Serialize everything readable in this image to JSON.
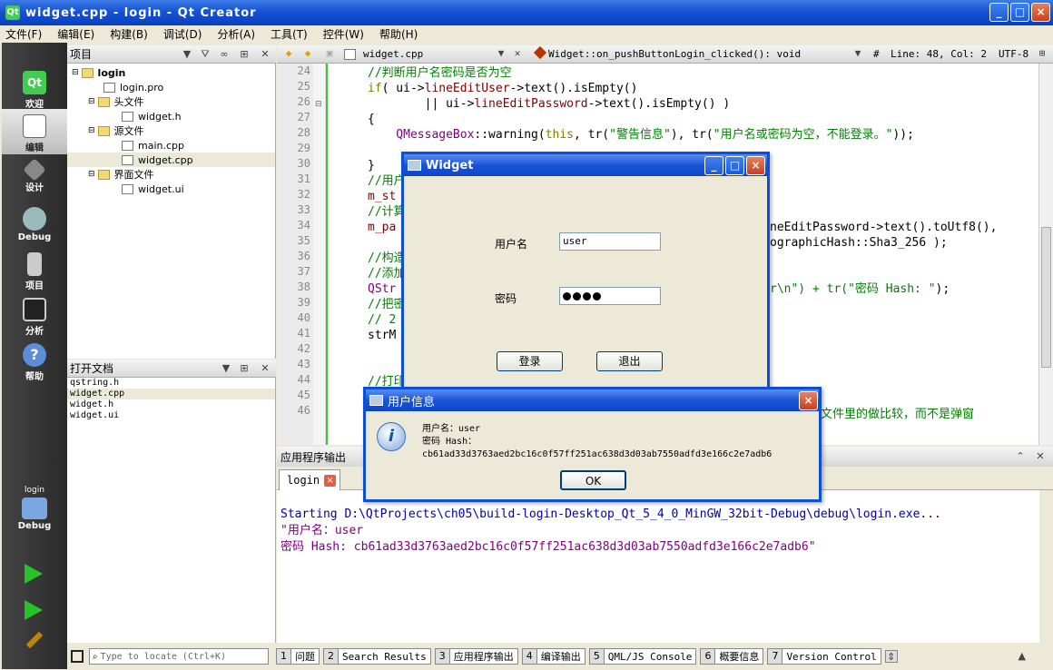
{
  "window": {
    "title": "widget.cpp - login - Qt Creator"
  },
  "menu": [
    "文件(F)",
    "编辑(E)",
    "构建(B)",
    "调试(D)",
    "分析(A)",
    "工具(T)",
    "控件(W)",
    "帮助(H)"
  ],
  "modes": [
    {
      "label": "欢迎",
      "icon": "qt-logo-icon"
    },
    {
      "label": "编辑",
      "icon": "edit-document-icon"
    },
    {
      "label": "设计",
      "icon": "design-pen-icon"
    },
    {
      "label": "Debug",
      "icon": "debug-bug-icon"
    },
    {
      "label": "项目",
      "icon": "project-icon"
    },
    {
      "label": "分析",
      "icon": "analyze-icon"
    },
    {
      "label": "帮助",
      "icon": "help-icon"
    }
  ],
  "target": {
    "project": "login",
    "config": "Debug"
  },
  "project_panel": {
    "title": "项目"
  },
  "tree": {
    "root": "login",
    "pro": "login.pro",
    "headers": "头文件",
    "header_file": "widget.h",
    "sources": "源文件",
    "source1": "main.cpp",
    "source2": "widget.cpp",
    "forms": "界面文件",
    "form_file": "widget.ui"
  },
  "open_docs": {
    "title": "打开文档",
    "items": [
      "qstring.h",
      "widget.cpp",
      "widget.h",
      "widget.ui"
    ]
  },
  "editor": {
    "file": "widget.cpp",
    "symbol": "Widget::on_pushButtonLogin_clicked(): void",
    "hash": "#",
    "position": "Line: 48, Col: 2",
    "encoding": "UTF-8"
  },
  "line_numbers": [
    "24",
    "25",
    "26",
    "27",
    "28",
    "29",
    "30",
    "31",
    "32",
    "33",
    "34",
    "35",
    "36",
    "37",
    "38",
    "39",
    "40",
    "41",
    "42",
    "43",
    "44",
    "45",
    "46"
  ],
  "code": {
    "l24": "//判断用户名密码是否为空",
    "l25a": "if",
    "l25b": "( ui->",
    "l25c": "lineEditUser",
    "l25d": "->text().isEmpty()",
    "l26a": "        || ui->",
    "l26b": "lineEditPassword",
    "l26c": "->text().isEmpty() )",
    "l27": "{",
    "l28a": "    QMessageBox",
    "l28b": "::warning(",
    "l28c": "this",
    "l28d": ", tr(",
    "l28e": "\"警告信息\"",
    "l28f": "), tr(",
    "l28g": "\"用户名或密码为空，不能登录。\"",
    "l28h": "));",
    "l30": "}",
    "l31": "//用户",
    "l32": "m_st",
    "l33": "//计算",
    "l34a": "m_pa",
    "l34b": "neEditPassword->text().toUtf8(),",
    "l35": "ographicHash::Sha3_256 );",
    "l36": "//构造",
    "l37": "//添加",
    "l38a": "QStr",
    "l38b": "r\\n\") + tr(",
    "l38c": "\"密码 Hash: \"",
    "l38d": ");",
    "l39": "//把密",
    "l40": "// 2",
    "l41": "strM",
    "l43": "//打印",
    "l45": "文件里的做比较，而不是弹窗"
  },
  "output": {
    "panel_title": "应用程序输出",
    "tab": "login",
    "lines": [
      "Starting D:\\QtProjects\\ch05\\build-login-Desktop_Qt_5_4_0_MinGW_32bit-Debug\\debug\\login.exe...",
      "\"用户名：user",
      "密码 Hash: cb61ad33d3763aed2bc16c0f57ff251ac638d3d03ab7550adfd3e166c2e7adb6\""
    ]
  },
  "login_dialog": {
    "title": "Widget",
    "user_label": "用户名",
    "user_value": "user",
    "password_label": "密码",
    "password_length": 4,
    "login_button": "登录",
    "exit_button": "退出"
  },
  "info_dialog": {
    "title": "用户信息",
    "line1": "用户名：user",
    "line2": "密码 Hash：",
    "line3": "cb61ad33d3763aed2bc16c0f57ff251ac638d3d03ab7550adfd3e166c2e7adb6",
    "ok_button": "OK"
  },
  "statusbar": {
    "locator_placeholder": "Type to locate (Ctrl+K)",
    "panes": [
      {
        "num": "1",
        "label": "问题"
      },
      {
        "num": "2",
        "label": "Search Results"
      },
      {
        "num": "3",
        "label": "应用程序输出"
      },
      {
        "num": "4",
        "label": "编译输出"
      },
      {
        "num": "5",
        "label": "QML/JS Console"
      },
      {
        "num": "6",
        "label": "概要信息"
      },
      {
        "num": "7",
        "label": "Version Control"
      }
    ]
  },
  "colors": {
    "titlebar": "#1553d4",
    "modebar": "#333333",
    "comment": "#008000",
    "member": "#800000"
  }
}
